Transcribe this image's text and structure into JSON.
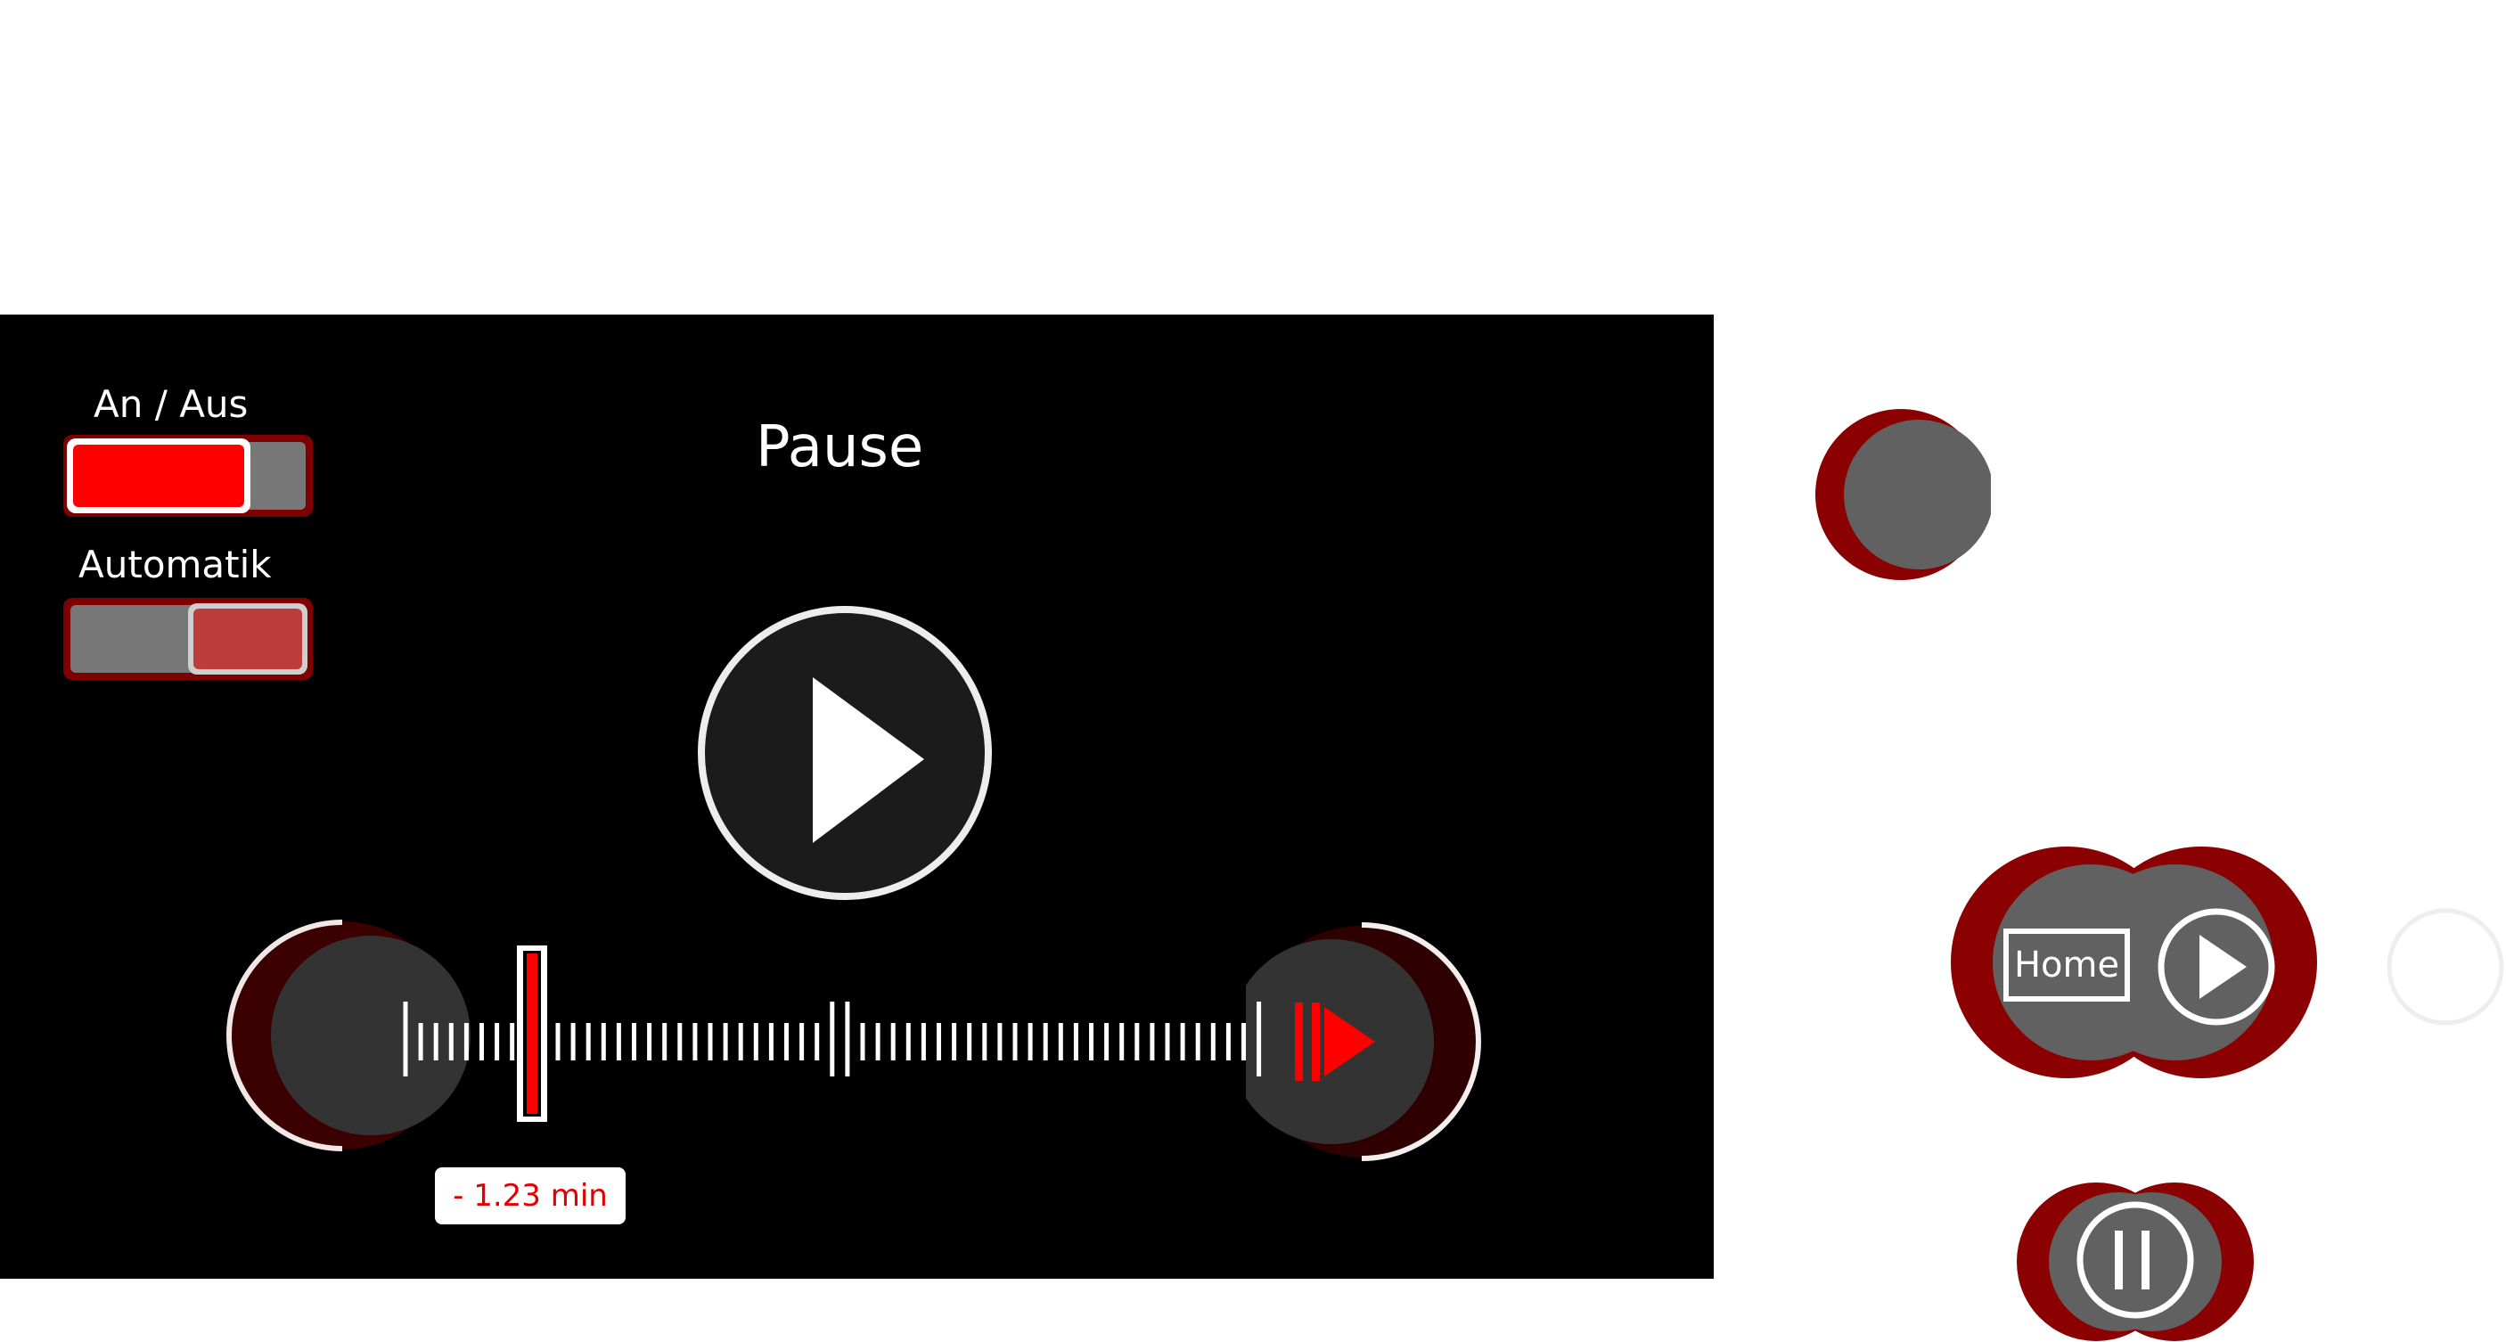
{
  "screen": {
    "title": "Pause",
    "toggle_power": {
      "label": "An / Aus",
      "state": "on"
    },
    "toggle_auto": {
      "label": "Automatik",
      "state": "off"
    },
    "timeline": {
      "time_badge": "-  1.23 min"
    }
  },
  "side": {
    "home_label": "Home"
  },
  "colors": {
    "accent_red": "#ff0000",
    "dark_red": "#8b0000",
    "grey": "#616161"
  }
}
